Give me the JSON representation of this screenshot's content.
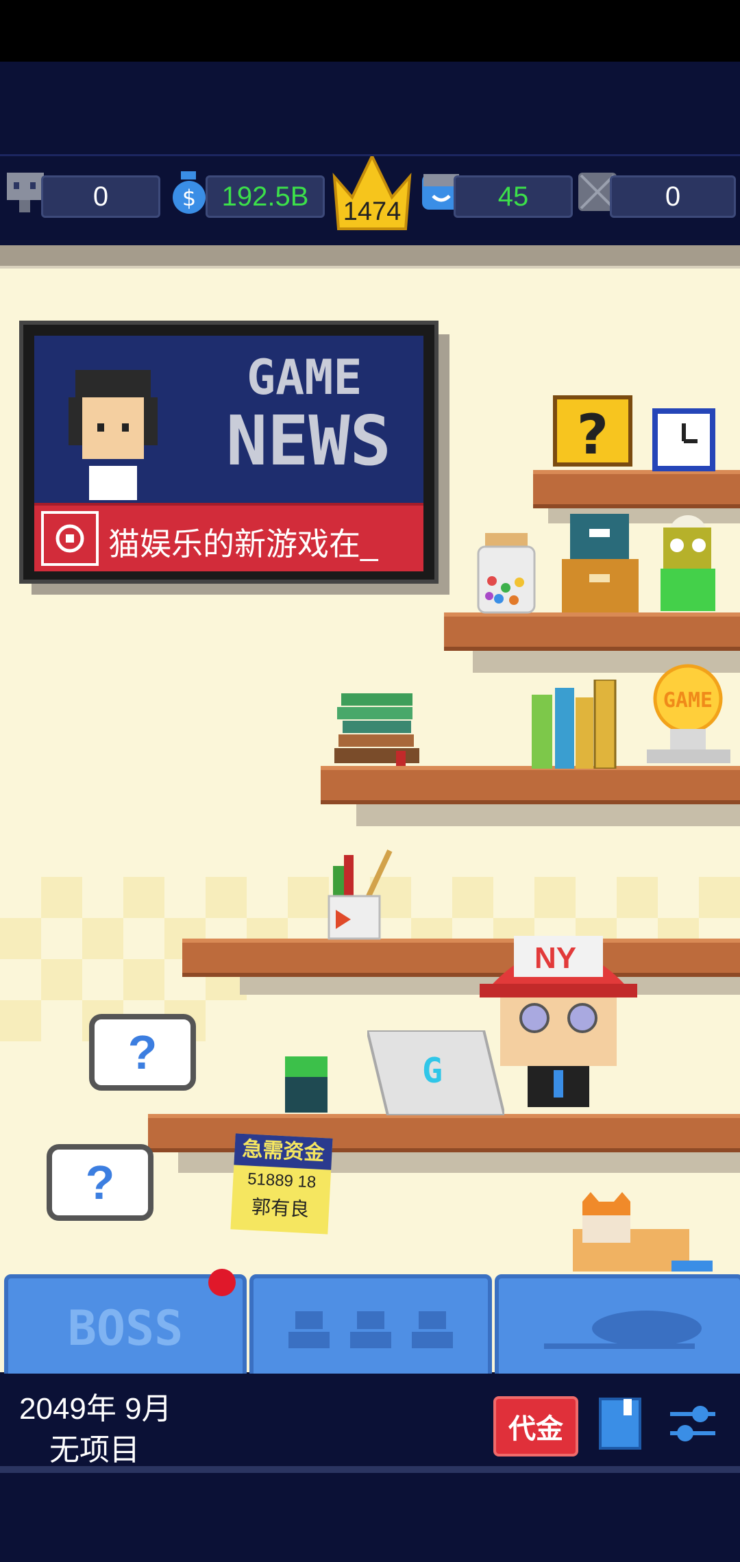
{
  "stats": {
    "staff": "0",
    "money": "192.5B",
    "rank": "1474",
    "fans": "45",
    "locked": "0"
  },
  "news": {
    "title_line1": "GAME",
    "title_line2": "NEWS",
    "ticker": "猫娱乐的新游戏在_"
  },
  "scene": {
    "cap_text": "NY",
    "laptop_logo": "G",
    "sticker_line1": "急需资金",
    "sticker_line2": "51889 18",
    "sticker_line3": "郭有良",
    "bulb_label": "GAME",
    "bubble_q": "?"
  },
  "buttons": {
    "boss": "BOSS"
  },
  "bottom": {
    "date": "2049年 9月",
    "project": "无项目",
    "voucher": "代金"
  },
  "colors": {
    "money_green": "#3ce04a",
    "notification_red": "#e0182a",
    "accent_blue": "#4f8fe4"
  }
}
